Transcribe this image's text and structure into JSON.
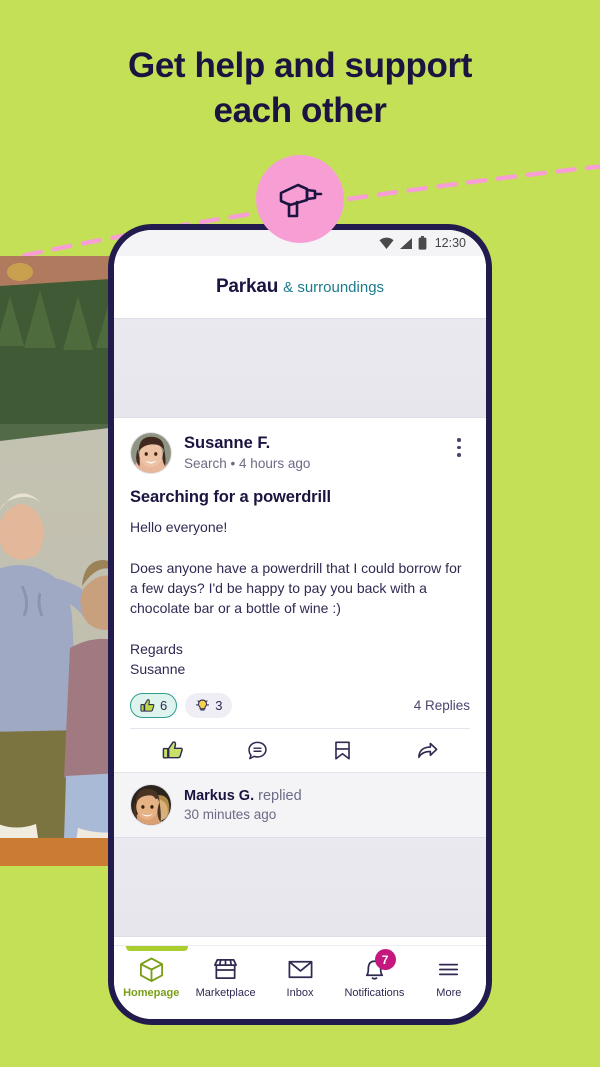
{
  "headline": {
    "line1": "Get help and support",
    "line2": "each other"
  },
  "theme": {
    "background": "#c3e057",
    "phone_frame": "#221b4d",
    "accent_navy": "#1c1440",
    "accent_teal": "#1c7b8c",
    "accent_pink": "#f79fd4",
    "accent_magenta": "#c4187e",
    "accent_green": "#aace2e",
    "band_orange": "#cc7b33"
  },
  "badge_bubble": {
    "icon": "power-drill-icon"
  },
  "statusbar": {
    "wifi_icon": "wifi-icon",
    "signal_icon": "cell-signal-icon",
    "battery_icon": "battery-icon",
    "clock": "12:30"
  },
  "app_header": {
    "city": "Parkau",
    "suffix": "& surroundings"
  },
  "post": {
    "author": "Susanne F.",
    "category": "Search",
    "timestamp": "4 hours ago",
    "meta_separator": "•",
    "avatar_icon": "user-avatar-susanne",
    "menu_icon": "more-options-icon",
    "title": "Searching for a powerdrill",
    "body": "Hello everyone!\n\nDoes anyone have a powerdrill that I could borrow for a few days? I'd be happy to pay you back with a chocolate bar or a bottle of wine :)\n\nRegards\nSusanne",
    "reactions": [
      {
        "icon": "thumbs-up-icon",
        "count": "6",
        "style": "like"
      },
      {
        "icon": "lightbulb-icon",
        "count": "3",
        "style": "idea"
      }
    ],
    "replies_label": "4 Replies",
    "actions": [
      {
        "icon": "thumbs-up-icon",
        "name": "like-action"
      },
      {
        "icon": "comment-icon",
        "name": "comment-action"
      },
      {
        "icon": "bookmark-icon",
        "name": "bookmark-action"
      },
      {
        "icon": "share-icon",
        "name": "share-action"
      }
    ]
  },
  "reply": {
    "author": "Markus G.",
    "verb": "replied",
    "timestamp": "30 minutes ago",
    "avatar_icon": "user-avatar-markus"
  },
  "bottom_nav": [
    {
      "label": "Homepage",
      "icon": "home-icon",
      "active": true
    },
    {
      "label": "Marketplace",
      "icon": "marketplace-icon",
      "active": false
    },
    {
      "label": "Inbox",
      "icon": "envelope-icon",
      "active": false
    },
    {
      "label": "Notifications",
      "icon": "bell-icon",
      "active": false,
      "badge": "7"
    },
    {
      "label": "More",
      "icon": "hamburger-menu-icon",
      "active": false
    }
  ]
}
